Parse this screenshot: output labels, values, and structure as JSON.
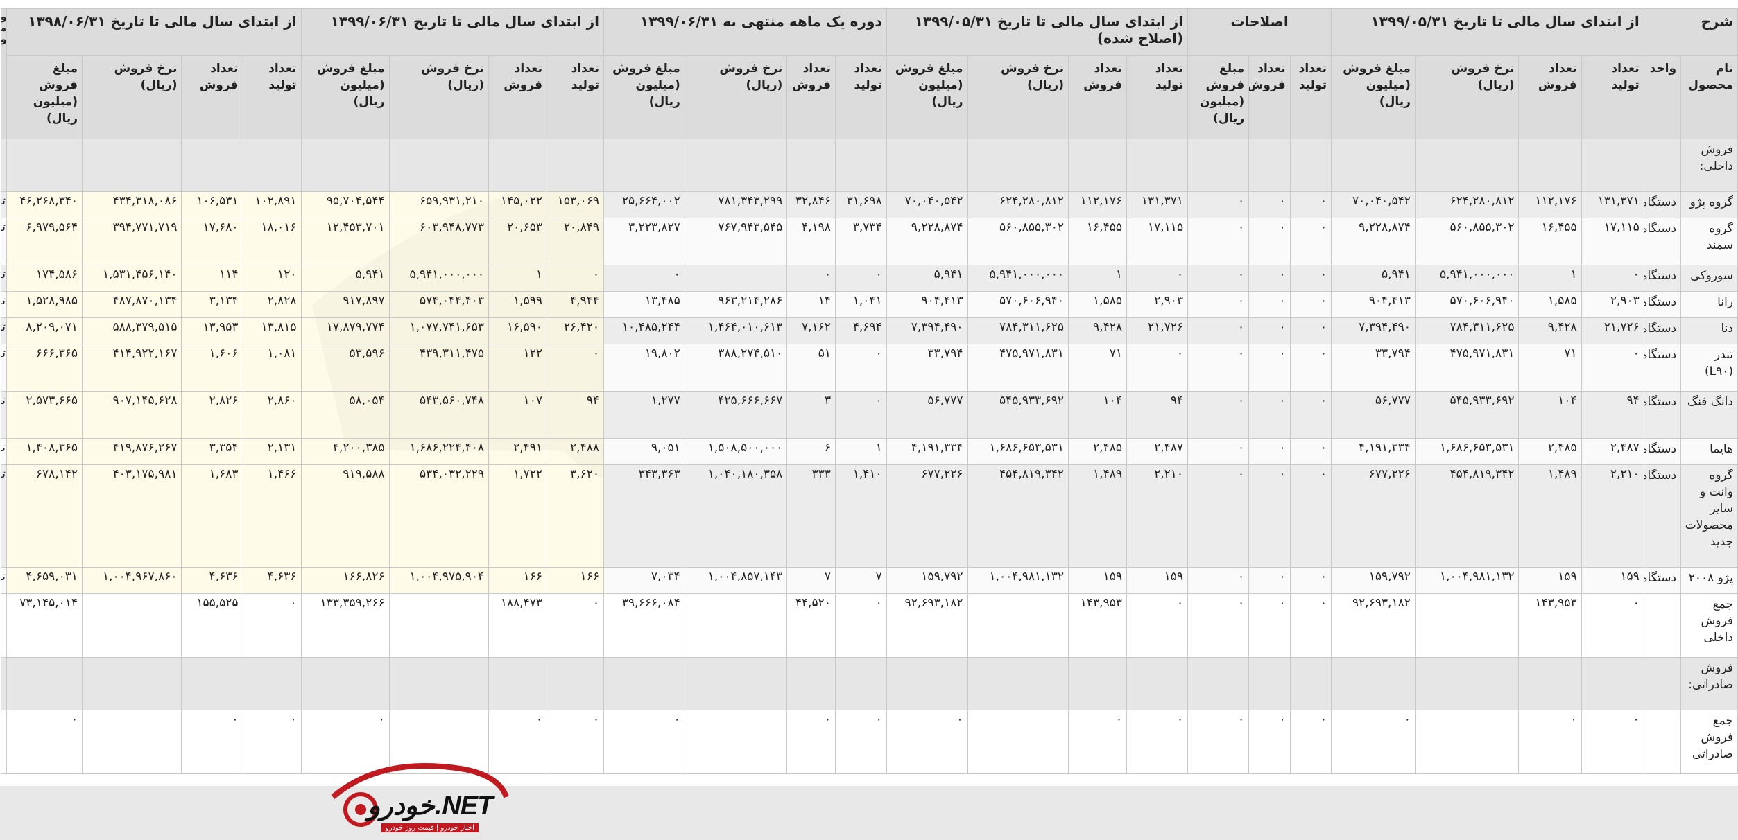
{
  "header": {
    "desc": "شرح",
    "groups": [
      "از ابتدای سال مالی تا تاریخ ۱۳۹۹/۰۵/۳۱",
      "اصلاحات",
      "از ابتدای سال مالی تا تاریخ ۱۳۹۹/۰۵/۳۱ (اصلاح شده)",
      "دوره یک ماهه منتهی به ۱۳۹۹/۰۶/۳۱",
      "از ابتدای سال مالی تا تاریخ ۱۳۹۹/۰۶/۳۱",
      "از ابتدای سال مالی تا تاریخ ۱۳۹۸/۰۶/۳۱",
      "وض محص و"
    ],
    "product": "نام محصول",
    "unit": "واحد",
    "cols4": [
      "تعداد تولید",
      "تعداد فروش",
      "نرخ فروش (ریال)",
      "مبلغ فروش (میلیون ریال)"
    ],
    "cols3": [
      "تعداد تولید",
      "تعداد فروش",
      "مبلغ فروش (میلیون ریال)"
    ]
  },
  "rows": [
    {
      "type": "blank",
      "name": "فروش داخلی:"
    },
    {
      "type": "data",
      "name": "گروه پژو",
      "unit": "دستگاه",
      "v": [
        "۱۳۱,۳۷۱",
        "۱۱۲,۱۷۶",
        "۶۲۴,۲۸۰,۸۱۲",
        "۷۰,۰۴۰,۵۴۲",
        "۰",
        "۰",
        "۰",
        "۱۳۱,۳۷۱",
        "۱۱۲,۱۷۶",
        "۶۲۴,۲۸۰,۸۱۲",
        "۷۰,۰۴۰,۵۴۲",
        "۳۱,۶۹۸",
        "۳۲,۸۴۶",
        "۷۸۱,۳۴۳,۲۹۹",
        "۲۵,۶۶۴,۰۰۲",
        "۱۵۳,۰۶۹",
        "۱۴۵,۰۲۲",
        "۶۵۹,۹۳۱,۲۱۰",
        "۹۵,۷۰۴,۵۴۴",
        "۱۰۲,۸۹۱",
        "۱۰۶,۵۳۱",
        "۴۳۴,۳۱۸,۰۸۶",
        "۴۶,۲۶۸,۳۴۰"
      ],
      "tail": "تولی"
    },
    {
      "type": "data",
      "name": "گروه سمند",
      "unit": "دستگاه",
      "v": [
        "۱۷,۱۱۵",
        "۱۶,۴۵۵",
        "۵۶۰,۸۵۵,۳۰۲",
        "۹,۲۲۸,۸۷۴",
        "۰",
        "۰",
        "۰",
        "۱۷,۱۱۵",
        "۱۶,۴۵۵",
        "۵۶۰,۸۵۵,۳۰۲",
        "۹,۲۲۸,۸۷۴",
        "۳,۷۳۴",
        "۴,۱۹۸",
        "۷۶۷,۹۴۳,۵۴۵",
        "۳,۲۲۳,۸۲۷",
        "۲۰,۸۴۹",
        "۲۰,۶۵۳",
        "۶۰۳,۹۴۸,۷۷۳",
        "۱۲,۴۵۳,۷۰۱",
        "۱۸,۰۱۶",
        "۱۷,۶۸۰",
        "۳۹۴,۷۷۱,۷۱۹",
        "۶,۹۷۹,۵۶۴"
      ],
      "tail": "تولی"
    },
    {
      "type": "data",
      "name": "سوروکی",
      "unit": "دستگاه",
      "v": [
        "۰",
        "۱",
        "۵,۹۴۱,۰۰۰,۰۰۰",
        "۵,۹۴۱",
        "۰",
        "۰",
        "۰",
        "۰",
        "۱",
        "۵,۹۴۱,۰۰۰,۰۰۰",
        "۵,۹۴۱",
        "۰",
        "۰",
        "",
        "۰",
        "۰",
        "۱",
        "۵,۹۴۱,۰۰۰,۰۰۰",
        "۵,۹۴۱",
        "۱۲۰",
        "۱۱۴",
        "۱,۵۳۱,۴۵۶,۱۴۰",
        "۱۷۴,۵۸۶"
      ],
      "tail": "تولی"
    },
    {
      "type": "data",
      "name": "رانا",
      "unit": "دستگاه",
      "v": [
        "۲,۹۰۳",
        "۱,۵۸۵",
        "۵۷۰,۶۰۶,۹۴۰",
        "۹۰۴,۴۱۳",
        "۰",
        "۰",
        "۰",
        "۲,۹۰۳",
        "۱,۵۸۵",
        "۵۷۰,۶۰۶,۹۴۰",
        "۹۰۴,۴۱۳",
        "۱,۰۴۱",
        "۱۴",
        "۹۶۳,۲۱۴,۲۸۶",
        "۱۳,۴۸۵",
        "۴,۹۴۴",
        "۱,۵۹۹",
        "۵۷۴,۰۴۴,۴۰۳",
        "۹۱۷,۸۹۷",
        "۲,۸۲۸",
        "۳,۱۳۴",
        "۴۸۷,۸۷۰,۱۳۴",
        "۱,۵۲۸,۹۸۵"
      ],
      "tail": "تولی"
    },
    {
      "type": "data",
      "name": "دنا",
      "unit": "دستگاه",
      "v": [
        "۲۱,۷۲۶",
        "۹,۴۲۸",
        "۷۸۴,۳۱۱,۶۲۵",
        "۷,۳۹۴,۴۹۰",
        "۰",
        "۰",
        "۰",
        "۲۱,۷۲۶",
        "۹,۴۲۸",
        "۷۸۴,۳۱۱,۶۲۵",
        "۷,۳۹۴,۴۹۰",
        "۴,۶۹۴",
        "۷,۱۶۲",
        "۱,۴۶۴,۰۱۰,۶۱۳",
        "۱۰,۴۸۵,۲۴۴",
        "۲۶,۴۲۰",
        "۱۶,۵۹۰",
        "۱,۰۷۷,۷۴۱,۶۵۳",
        "۱۷,۸۷۹,۷۷۴",
        "۱۳,۸۱۵",
        "۱۳,۹۵۳",
        "۵۸۸,۳۷۹,۵۱۵",
        "۸,۲۰۹,۰۷۱"
      ],
      "tail": "تولی"
    },
    {
      "type": "data",
      "name": "تندر (L۹۰)",
      "unit": "دستگاه",
      "v": [
        "۰",
        "۷۱",
        "۴۷۵,۹۷۱,۸۳۱",
        "۳۳,۷۹۴",
        "۰",
        "۰",
        "۰",
        "۰",
        "۷۱",
        "۴۷۵,۹۷۱,۸۳۱",
        "۳۳,۷۹۴",
        "۰",
        "۵۱",
        "۳۸۸,۲۷۴,۵۱۰",
        "۱۹,۸۰۲",
        "۰",
        "۱۲۲",
        "۴۳۹,۳۱۱,۴۷۵",
        "۵۳,۵۹۶",
        "۱,۰۸۱",
        "۱,۶۰۶",
        "۴۱۴,۹۲۲,۱۶۷",
        "۶۶۶,۳۶۵"
      ],
      "tail": "تولی"
    },
    {
      "type": "data",
      "name": "دانگ فنگ",
      "unit": "دستگاه",
      "v": [
        "۹۴",
        "۱۰۴",
        "۵۴۵,۹۳۳,۶۹۲",
        "۵۶,۷۷۷",
        "۰",
        "۰",
        "۰",
        "۹۴",
        "۱۰۴",
        "۵۴۵,۹۳۳,۶۹۲",
        "۵۶,۷۷۷",
        "۰",
        "۳",
        "۴۲۵,۶۶۶,۶۶۷",
        "۱,۲۷۷",
        "۹۴",
        "۱۰۷",
        "۵۴۳,۵۶۰,۷۴۸",
        "۵۸,۰۵۴",
        "۲,۸۶۰",
        "۲,۸۲۶",
        "۹۰۷,۱۴۵,۶۲۸",
        "۲,۵۷۳,۶۶۵"
      ],
      "tail": "تولی"
    },
    {
      "type": "data",
      "name": "هایما",
      "unit": "دستگاه",
      "v": [
        "۲,۴۸۷",
        "۲,۴۸۵",
        "۱,۶۸۶,۶۵۳,۵۳۱",
        "۴,۱۹۱,۳۳۴",
        "۰",
        "۰",
        "۰",
        "۲,۴۸۷",
        "۲,۴۸۵",
        "۱,۶۸۶,۶۵۳,۵۳۱",
        "۴,۱۹۱,۳۳۴",
        "۱",
        "۶",
        "۱,۵۰۸,۵۰۰,۰۰۰",
        "۹,۰۵۱",
        "۲,۴۸۸",
        "۲,۴۹۱",
        "۱,۶۸۶,۲۲۴,۴۰۸",
        "۴,۲۰۰,۳۸۵",
        "۲,۱۳۱",
        "۳,۳۵۴",
        "۴۱۹,۸۷۶,۲۶۷",
        "۱,۴۰۸,۳۶۵"
      ],
      "tail": "تولی"
    },
    {
      "type": "data",
      "tall": true,
      "name": "گروه وانت و سایر محصولات جدید",
      "unit": "دستگاه",
      "v": [
        "۲,۲۱۰",
        "۱,۴۸۹",
        "۴۵۴,۸۱۹,۳۴۲",
        "۶۷۷,۲۲۶",
        "۰",
        "۰",
        "۰",
        "۲,۲۱۰",
        "۱,۴۸۹",
        "۴۵۴,۸۱۹,۳۴۲",
        "۶۷۷,۲۲۶",
        "۱,۴۱۰",
        "۳۳۳",
        "۱,۰۴۰,۱۸۰,۳۵۸",
        "۳۴۳,۳۶۳",
        "۳,۶۲۰",
        "۱,۷۲۲",
        "۵۳۴,۰۳۲,۲۲۹",
        "۹۱۹,۵۸۸",
        "۱,۴۶۶",
        "۱,۶۸۳",
        "۴۰۳,۱۷۵,۹۸۱",
        "۶۷۸,۱۴۲"
      ],
      "tail": "تولی"
    },
    {
      "type": "data",
      "name": "پژو ۲۰۰۸",
      "unit": "دستگاه",
      "v": [
        "۱۵۹",
        "۱۵۹",
        "۱,۰۰۴,۹۸۱,۱۳۲",
        "۱۵۹,۷۹۲",
        "۰",
        "۰",
        "۰",
        "۱۵۹",
        "۱۵۹",
        "۱,۰۰۴,۹۸۱,۱۳۲",
        "۱۵۹,۷۹۲",
        "۷",
        "۷",
        "۱,۰۰۴,۸۵۷,۱۴۳",
        "۷,۰۳۴",
        "۱۶۶",
        "۱۶۶",
        "۱,۰۰۴,۹۷۵,۹۰۴",
        "۱۶۶,۸۲۶",
        "۴,۶۳۶",
        "۴,۶۳۶",
        "۱,۰۰۴,۹۶۷,۸۶۰",
        "۴,۶۵۹,۰۳۱"
      ],
      "tail": "تولی"
    },
    {
      "type": "total",
      "name": "جمع فروش داخلی",
      "unit": "",
      "v": [
        "۰",
        "۱۴۳,۹۵۳",
        "",
        "۹۲,۶۹۳,۱۸۲",
        "۰",
        "۰",
        "۰",
        "۰",
        "۱۴۳,۹۵۳",
        "",
        "۹۲,۶۹۳,۱۸۲",
        "۰",
        "۴۴,۵۲۰",
        "",
        "۳۹,۶۶۶,۰۸۴",
        "۰",
        "۱۸۸,۴۷۳",
        "",
        "۱۳۳,۳۵۹,۲۶۶",
        "۰",
        "۱۵۵,۵۲۵",
        "",
        "۷۳,۱۴۵,۰۱۴"
      ],
      "tail": ""
    },
    {
      "type": "blank",
      "name": "فروش صادراتی:"
    },
    {
      "type": "total",
      "name": "جمع فروش صادراتی",
      "unit": "",
      "v": [
        "۰",
        "۰",
        "",
        "۰",
        "۰",
        "۰",
        "۰",
        "۰",
        "۰",
        "",
        "۰",
        "۰",
        "۰",
        "",
        "۰",
        "۰",
        "۰",
        "",
        "۰",
        "۰",
        "۰",
        "",
        "۰"
      ],
      "tail": ""
    }
  ],
  "logo": {
    "text": "خودرو.NET",
    "sub": "اخبار خودرو | قیمت روز خودرو"
  }
}
